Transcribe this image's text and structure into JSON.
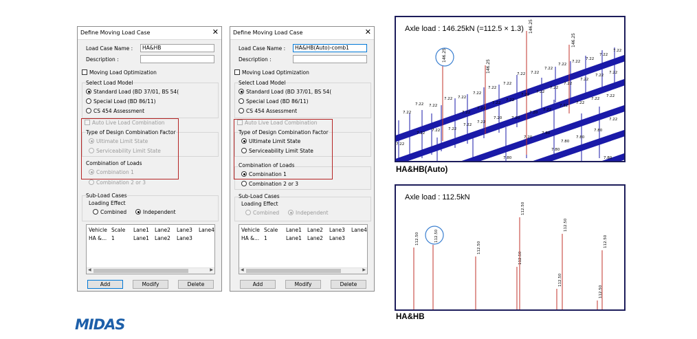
{
  "dialog_a": {
    "title": "Define Moving Load Case",
    "close_glyph": "✕",
    "load_case_name_label": "Load Case Name :",
    "load_case_name_value": "HA&HB",
    "description_label": "Description :",
    "description_value": "",
    "optimization_label": "Moving Load Optimization",
    "select_load_model_label": "Select Load Model",
    "standard_load_label": "Standard Load (BD 37/01, BS 54(",
    "special_load_label": "Special Load (BD 86/11)",
    "cs454_label": "CS 454 Assessment",
    "auto_live_label": "Auto Live Load Combination",
    "design_factor_label": "Type of Design Combination Factor",
    "uls_label": "Ultimate Limit State",
    "sls_label": "Serviceability Limit State",
    "combination_label": "Combination of Loads",
    "combination1_label": "Combination 1",
    "combination23_label": "Combination 2 or 3",
    "subload_label": "Sub-Load Cases",
    "loading_effect_label": "Loading Effect",
    "combined_label": "Combined",
    "independent_label": "Independent",
    "list_headers": [
      "Vehicle",
      "Scale",
      "Lane1",
      "Lane2",
      "Lane3",
      "Lane4"
    ],
    "list_row": [
      "HA &...",
      "1",
      "Lane1",
      "Lane2",
      "Lane3",
      ""
    ],
    "add_label": "Add",
    "modify_label": "Modify",
    "delete_label": "Delete"
  },
  "dialog_b": {
    "title": "Define Moving Load Case",
    "close_glyph": "✕",
    "load_case_name_label": "Load Case Name :",
    "load_case_name_value": "HA&HB(Auto)-comb1",
    "description_label": "Description :",
    "description_value": "",
    "optimization_label": "Moving Load Optimization",
    "select_load_model_label": "Select Load Model",
    "standard_load_label": "Standard Load (BD 37/01, BS 54(",
    "special_load_label": "Special Load (BD 86/11)",
    "cs454_label": "CS 454 Assessment",
    "auto_live_label": "Auto Live Load Combination",
    "design_factor_label": "Type of Design Combination Factor",
    "uls_label": "Ultimate Limit State",
    "sls_label": "Serviceability Limit State",
    "combination_label": "Combination of Loads",
    "combination1_label": "Combination 1",
    "combination23_label": "Combination 2 or 3",
    "subload_label": "Sub-Load Cases",
    "loading_effect_label": "Loading Effect",
    "combined_label": "Combined",
    "independent_label": "Independent",
    "list_headers": [
      "Vehicle",
      "Scale",
      "Lane1",
      "Lane2",
      "Lane3",
      "Lane4"
    ],
    "list_row": [
      "HA &...",
      "1",
      "Lane1",
      "Lane2",
      "Lane3",
      ""
    ],
    "add_label": "Add",
    "modify_label": "Modify",
    "delete_label": "Delete"
  },
  "top_panel": {
    "title": "Axle load : 146.25kN (=112.5 × 1.3)",
    "caption": "HA&HB(Auto)",
    "peak_label": "146.25",
    "mid_label": "7.22",
    "low_label": "7.20",
    "bottom_label": "7.80",
    "accent": "#1a1aa8",
    "load_line_color": "#c0302a"
  },
  "bottom_panel": {
    "title": "Axle load : 112.5kN",
    "caption": "HA&HB",
    "axle_label": "112.50",
    "load_line_color": "#c0302a",
    "highlight_color": "#3a7fd0"
  },
  "logo": {
    "text": "MIDAS",
    "color": "#1d5fa9"
  }
}
